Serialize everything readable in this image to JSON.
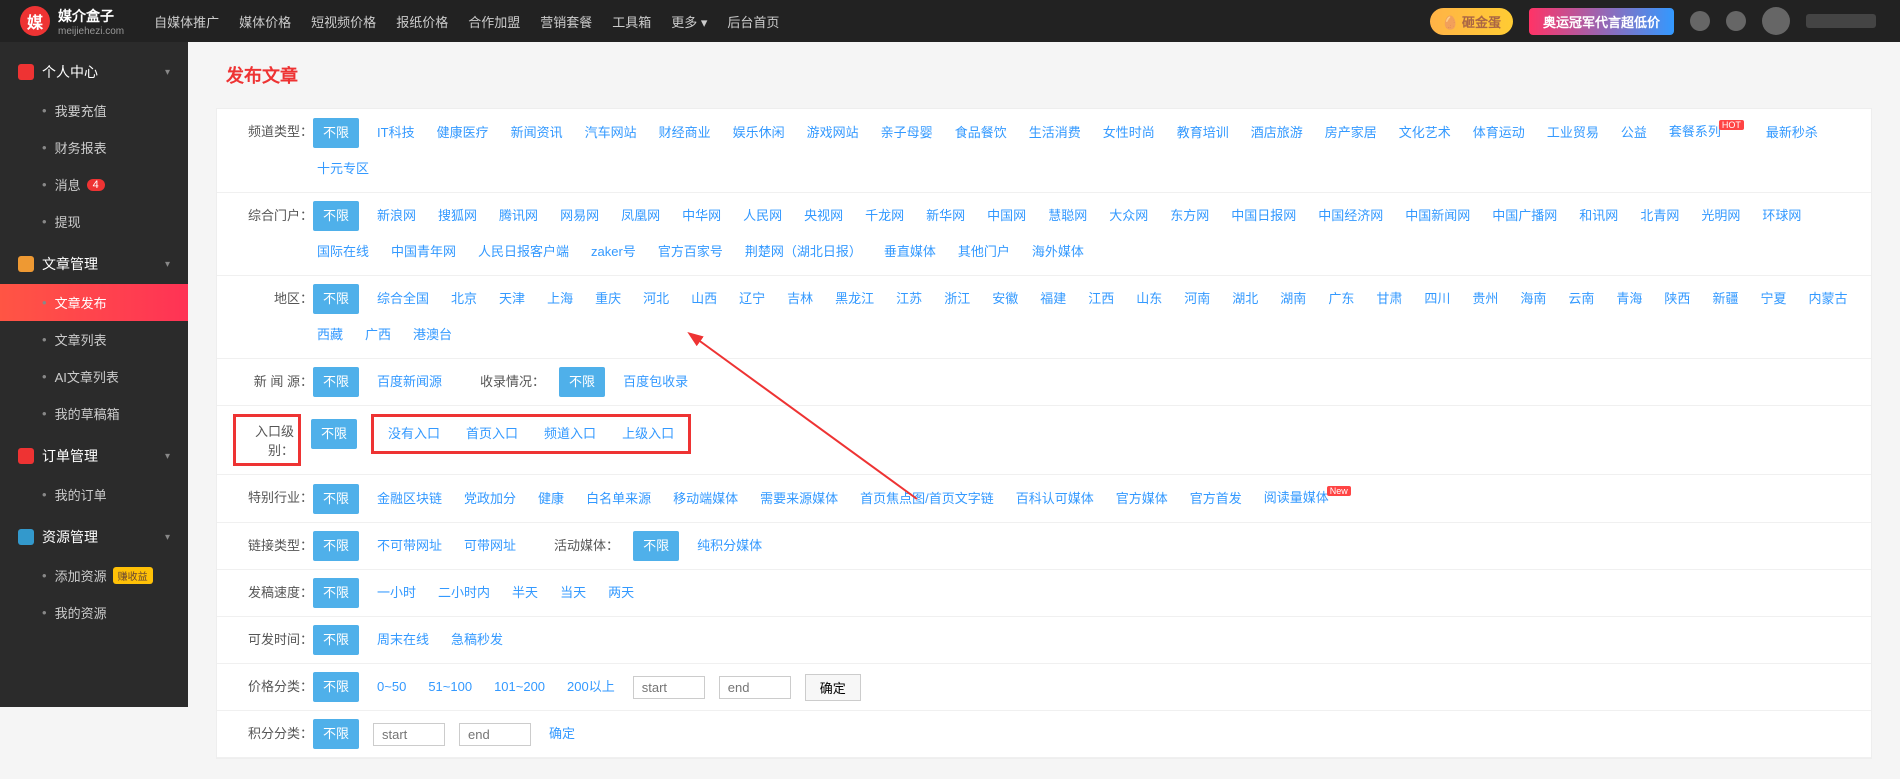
{
  "logo": {
    "char": "媒",
    "title": "媒介盒子",
    "sub": "meijiehezi.com"
  },
  "topnav": [
    "自媒体推广",
    "媒体价格",
    "短视频价格",
    "报纸价格",
    "合作加盟",
    "营销套餐",
    "工具箱",
    "更多 ▾",
    "后台首页"
  ],
  "topbadges": {
    "egg": "🥚 砸金蛋",
    "olympic": "奥运冠军代言超低价"
  },
  "sidebar": [
    {
      "icon": "red",
      "title": "个人中心",
      "items": [
        {
          "label": "我要充值"
        },
        {
          "label": "财务报表"
        },
        {
          "label": "消息",
          "badge": "4"
        },
        {
          "label": "提现"
        }
      ]
    },
    {
      "icon": "yellow",
      "title": "文章管理",
      "items": [
        {
          "label": "文章发布",
          "active": true
        },
        {
          "label": "文章列表"
        },
        {
          "label": "AI文章列表"
        },
        {
          "label": "我的草稿箱"
        }
      ]
    },
    {
      "icon": "red",
      "title": "订单管理",
      "items": [
        {
          "label": "我的订单"
        }
      ]
    },
    {
      "icon": "blue",
      "title": "资源管理",
      "items": [
        {
          "label": "添加资源",
          "tag": "赚收益"
        },
        {
          "label": "我的资源"
        }
      ]
    }
  ],
  "pageTitle": "发布文章",
  "filters": {
    "channel": {
      "label": "频道类型：",
      "active": "不限",
      "opts": [
        "IT科技",
        "健康医疗",
        "新闻资讯",
        "汽车网站",
        "财经商业",
        "娱乐休闲",
        "游戏网站",
        "亲子母婴",
        "食品餐饮",
        "生活消费",
        "女性时尚",
        "教育培训",
        "酒店旅游",
        "房产家居",
        "文化艺术",
        "体育运动",
        "工业贸易",
        "公益"
      ],
      "tagged": [
        {
          "text": "套餐系列",
          "tag": "HOT"
        }
      ],
      "more": [
        "最新秒杀",
        "十元专区"
      ]
    },
    "portal": {
      "label": "综合门户：",
      "active": "不限",
      "opts": [
        "新浪网",
        "搜狐网",
        "腾讯网",
        "网易网",
        "凤凰网",
        "中华网",
        "人民网",
        "央视网",
        "千龙网",
        "新华网",
        "中国网",
        "慧聪网",
        "大众网",
        "东方网",
        "中国日报网",
        "中国经济网",
        "中国新闻网",
        "中国广播网",
        "和讯网",
        "北青网",
        "光明网",
        "环球网",
        "国际在线",
        "中国青年网",
        "人民日报客户端",
        "zaker号",
        "官方百家号",
        "荆楚网（湖北日报）",
        "垂直媒体",
        "其他门户",
        "海外媒体"
      ]
    },
    "region": {
      "label": "地区：",
      "active": "不限",
      "opts": [
        "综合全国",
        "北京",
        "天津",
        "上海",
        "重庆",
        "河北",
        "山西",
        "辽宁",
        "吉林",
        "黑龙江",
        "江苏",
        "浙江",
        "安徽",
        "福建",
        "江西",
        "山东",
        "河南",
        "湖北",
        "湖南",
        "广东",
        "甘肃",
        "四川",
        "贵州",
        "海南",
        "云南",
        "青海",
        "陕西",
        "新疆",
        "宁夏",
        "内蒙古",
        "西藏",
        "广西",
        "港澳台"
      ]
    },
    "news": {
      "label": "新 闻 源：",
      "active": "不限",
      "opts": [
        "百度新闻源"
      ],
      "sub": {
        "label": "收录情况：",
        "active": "不限",
        "opts": [
          "百度包收录"
        ]
      }
    },
    "entry": {
      "label": "入口级别：",
      "active": "不限",
      "opts": [
        "没有入口",
        "首页入口",
        "频道入口",
        "上级入口"
      ]
    },
    "industry": {
      "label": "特别行业：",
      "active": "不限",
      "opts": [
        "金融区块链",
        "党政加分",
        "健康",
        "白名单来源",
        "移动端媒体",
        "需要来源媒体",
        "首页焦点图/首页文字链",
        "百科认可媒体",
        "官方媒体",
        "官方首发"
      ],
      "tagged": [
        {
          "text": "阅读量媒体",
          "tag": "New"
        }
      ]
    },
    "link": {
      "label": "链接类型：",
      "active": "不限",
      "opts": [
        "不可带网址",
        "可带网址"
      ],
      "sub": {
        "label": "活动媒体：",
        "active": "不限",
        "opts": [
          "纯积分媒体"
        ]
      }
    },
    "speed": {
      "label": "发稿速度：",
      "active": "不限",
      "opts": [
        "一小时",
        "二小时内",
        "半天",
        "当天",
        "两天"
      ]
    },
    "time": {
      "label": "可发时间：",
      "active": "不限",
      "opts": [
        "周末在线",
        "急稿秒发"
      ]
    },
    "price": {
      "label": "价格分类：",
      "active": "不限",
      "opts": [
        "0~50",
        "51~100",
        "101~200",
        "200以上"
      ],
      "inputs": {
        "start": "start",
        "end": "end",
        "btn": "确定"
      }
    },
    "points": {
      "label": "积分分类：",
      "active": "不限",
      "opts": [],
      "inputs": {
        "start": "start",
        "end": "end",
        "btn": "确定"
      }
    }
  }
}
